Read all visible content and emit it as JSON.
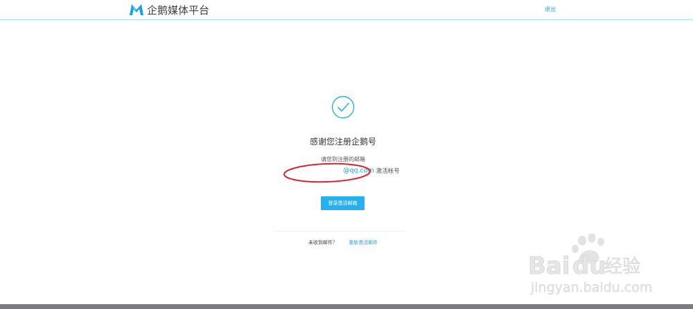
{
  "header": {
    "logo_text": "企鹅媒体平台",
    "logout_label": "退出"
  },
  "main": {
    "success_icon": "check-circle-icon",
    "title": "感谢您注册企鹅号",
    "instruction": "请您到注册的邮箱",
    "email": {
      "masked_prefix": "· · ·    · · · ·",
      "domain": "@qq.com",
      "suffix": "激活帐号"
    },
    "login_button_label": "登录激活邮箱",
    "resend_prompt": "未收到邮件？",
    "resend_link_label": "重新激活邮件"
  },
  "watermark": {
    "brand_part1": "Bai",
    "brand_part2": "du",
    "brand_cn": "经验",
    "url": "jingyan.baidu.com"
  },
  "colors": {
    "accent": "#26b0f0",
    "link": "#2aa3e0",
    "annotation_red": "#d9232e",
    "header_border": "#a9dcef",
    "footer": "#7a7d80"
  }
}
